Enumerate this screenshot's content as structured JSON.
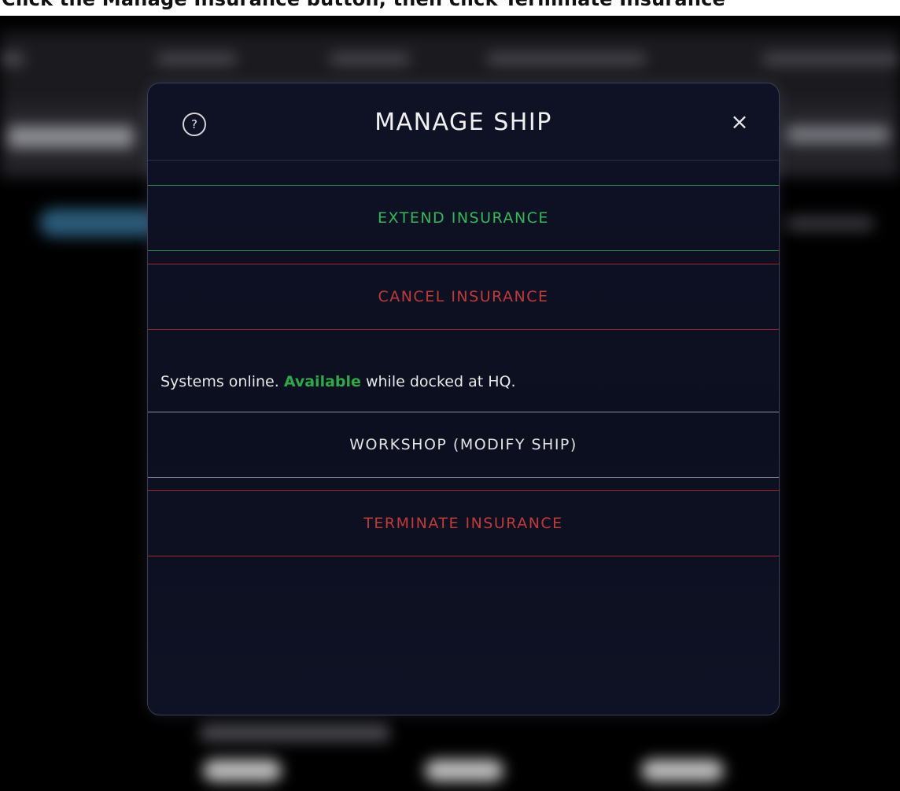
{
  "heading": {
    "text": "Click the Manage Insurance button, then click Terminate Insurance"
  },
  "modal": {
    "help_icon_glyph": "?",
    "title": "MANAGE SHIP",
    "close_glyph": "×",
    "actions": {
      "extend_insurance": "EXTEND INSURANCE",
      "cancel_insurance": "CANCEL INSURANCE",
      "workshop": "WORKSHOP (MODIFY SHIP)",
      "terminate_insurance": "TERMINATE INSURANCE"
    },
    "status": {
      "prefix": "Systems online. ",
      "available": "Available",
      "suffix": " while docked at HQ."
    }
  },
  "colors": {
    "modal_background": "#0c0f1f",
    "extend_green": "#33b85a",
    "danger_red": "#c03a3a",
    "available_green": "#2fa84a",
    "neutral_border": "#8a8fa3"
  },
  "icons": {
    "help": "question-circle-icon",
    "close": "close-icon"
  }
}
